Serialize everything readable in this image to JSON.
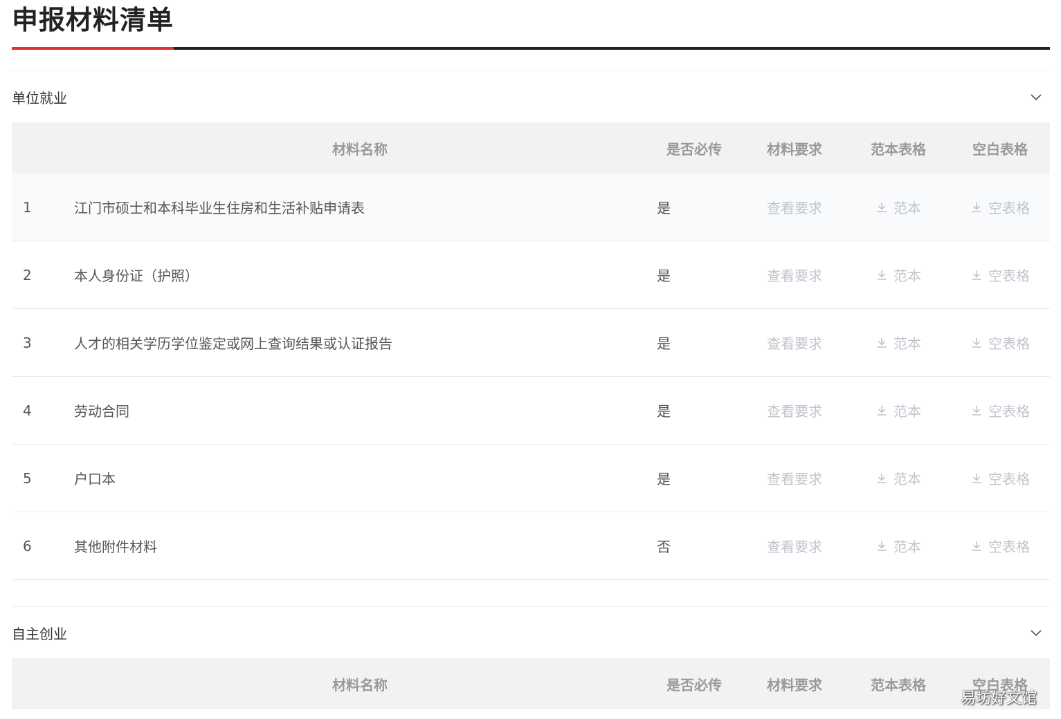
{
  "page": {
    "title": "申报材料清单"
  },
  "table_headers": {
    "name": "材料名称",
    "required": "是否必传",
    "requirements": "材料要求",
    "sample": "范本表格",
    "blank": "空白表格"
  },
  "actions": {
    "view_requirements": "查看要求",
    "sample": "范本",
    "blank": "空表格"
  },
  "sections": [
    {
      "title": "单位就业",
      "rows": [
        {
          "index": "1",
          "name": "江门市硕士和本科毕业生住房和生活补贴申请表",
          "required": "是"
        },
        {
          "index": "2",
          "name": "本人身份证（护照）",
          "required": "是"
        },
        {
          "index": "3",
          "name": "人才的相关学历学位鉴定或网上查询结果或认证报告",
          "required": "是"
        },
        {
          "index": "4",
          "name": "劳动合同",
          "required": "是"
        },
        {
          "index": "5",
          "name": "户口本",
          "required": "是"
        },
        {
          "index": "6",
          "name": "其他附件材料",
          "required": "否"
        }
      ]
    },
    {
      "title": "自主创业",
      "rows": []
    }
  ],
  "watermark": "易坊好文馆",
  "colors": {
    "accent": "#e5312f",
    "link_disabled": "#c0c4cc",
    "header_bg": "#f2f2f2"
  }
}
